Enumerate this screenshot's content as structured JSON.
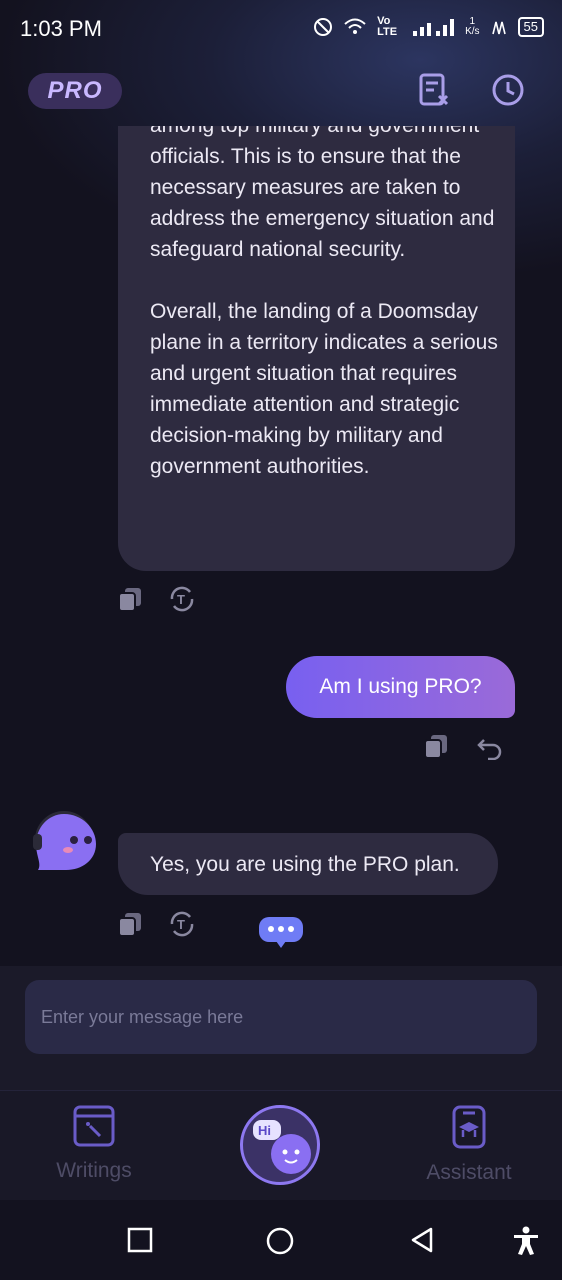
{
  "status_bar": {
    "time": "1:03 PM",
    "network_label": "Vo LTE",
    "speed_value": "1",
    "speed_unit": "K/s",
    "battery": "55"
  },
  "header": {
    "badge": "PRO",
    "icons": [
      "clear-chat-icon",
      "history-icon"
    ]
  },
  "chat": {
    "messages": [
      {
        "role": "assistant",
        "paragraphs": [
          "among top military and government officials. This is to ensure that the necessary measures are taken to address the emergency situation and safeguard national security.",
          "Overall, the landing of a Doomsday plane in a territory indicates a serious and urgent situation that requires immediate attention and strategic decision-making by military and government authorities."
        ],
        "actions": [
          "copy-icon",
          "translate-icon"
        ]
      },
      {
        "role": "user",
        "text": "Am I using PRO?",
        "actions": [
          "copy-icon",
          "undo-icon"
        ]
      },
      {
        "role": "assistant",
        "text": "Yes, you are using the PRO plan.",
        "actions": [
          "copy-icon",
          "translate-icon"
        ]
      }
    ]
  },
  "input": {
    "placeholder": "Enter your message here",
    "value": ""
  },
  "bottom_nav": {
    "items": [
      {
        "label": "Writings",
        "icon": "writings-icon"
      },
      {
        "label": "",
        "icon": "hi-chat-icon"
      },
      {
        "label": "Assistant",
        "icon": "assistant-icon"
      }
    ]
  },
  "colors": {
    "background": "#13121f",
    "bot_bubble": "#2e2b40",
    "user_bubble_start": "#7860f0",
    "user_bubble_end": "#9a6ad8",
    "accent": "#8d78f0",
    "input_bg": "#2a2a47"
  }
}
